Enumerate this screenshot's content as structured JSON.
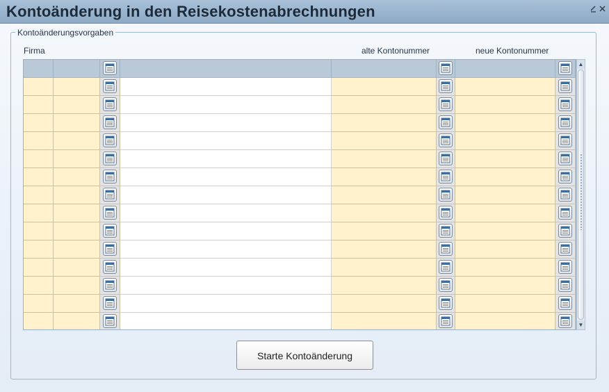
{
  "window": {
    "title": "Kontoänderung in den Reisekostenabrechnungen",
    "controls": [
      "minimize-icon",
      "close-icon"
    ]
  },
  "group": {
    "legend": "Kontoänderungsvorgaben"
  },
  "grid": {
    "headers": {
      "firma": "Firma",
      "alte_kontonummer": "alte Kontonummer",
      "neue_kontonummer": "neue Kontonummer"
    },
    "row_count": 14,
    "rows": [
      {
        "firma": "",
        "code": "",
        "text": "",
        "alte_kontonummer": "",
        "neue_kontonummer": ""
      },
      {
        "firma": "",
        "code": "",
        "text": "",
        "alte_kontonummer": "",
        "neue_kontonummer": ""
      },
      {
        "firma": "",
        "code": "",
        "text": "",
        "alte_kontonummer": "",
        "neue_kontonummer": ""
      },
      {
        "firma": "",
        "code": "",
        "text": "",
        "alte_kontonummer": "",
        "neue_kontonummer": ""
      },
      {
        "firma": "",
        "code": "",
        "text": "",
        "alte_kontonummer": "",
        "neue_kontonummer": ""
      },
      {
        "firma": "",
        "code": "",
        "text": "",
        "alte_kontonummer": "",
        "neue_kontonummer": ""
      },
      {
        "firma": "",
        "code": "",
        "text": "",
        "alte_kontonummer": "",
        "neue_kontonummer": ""
      },
      {
        "firma": "",
        "code": "",
        "text": "",
        "alte_kontonummer": "",
        "neue_kontonummer": ""
      },
      {
        "firma": "",
        "code": "",
        "text": "",
        "alte_kontonummer": "",
        "neue_kontonummer": ""
      },
      {
        "firma": "",
        "code": "",
        "text": "",
        "alte_kontonummer": "",
        "neue_kontonummer": ""
      },
      {
        "firma": "",
        "code": "",
        "text": "",
        "alte_kontonummer": "",
        "neue_kontonummer": ""
      },
      {
        "firma": "",
        "code": "",
        "text": "",
        "alte_kontonummer": "",
        "neue_kontonummer": ""
      },
      {
        "firma": "",
        "code": "",
        "text": "",
        "alte_kontonummer": "",
        "neue_kontonummer": ""
      },
      {
        "firma": "",
        "code": "",
        "text": "",
        "alte_kontonummer": "",
        "neue_kontonummer": ""
      }
    ],
    "colors": {
      "editable_cell": "#fff2cc",
      "header_row": "#b9c9d8",
      "text_cell": "#ffffff"
    }
  },
  "actions": {
    "start_label": "Starte Kontoänderung"
  }
}
